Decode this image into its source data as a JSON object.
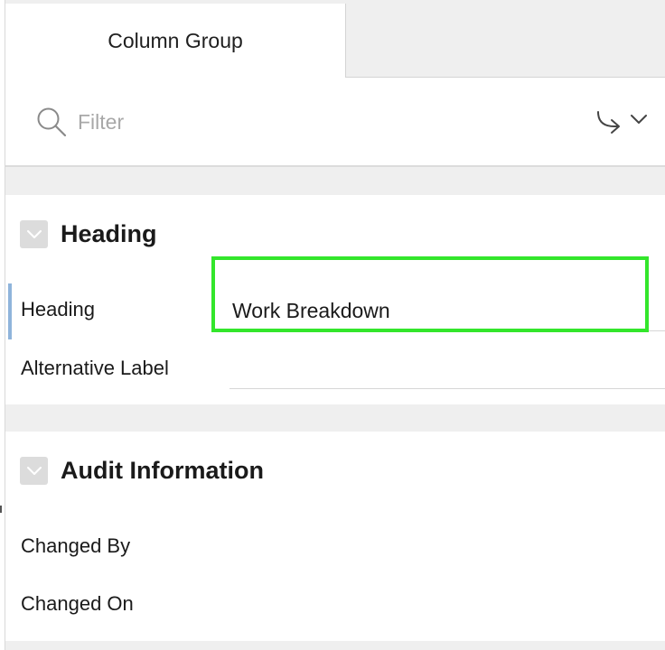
{
  "tabs": [
    {
      "label": "Column Group",
      "active": true
    }
  ],
  "toolbar": {
    "filter_placeholder": "Filter",
    "search_icon": "search-icon",
    "goto_icon": "goto-arrow-chevron-icon"
  },
  "sections": {
    "heading": {
      "title": "Heading",
      "fields": {
        "heading_label": "Heading",
        "heading_value": "Work Breakdown",
        "alt_label": "Alternative Label",
        "alt_value": ""
      }
    },
    "audit": {
      "title": "Audit Information",
      "fields": {
        "changed_by_label": "Changed By",
        "changed_on_label": "Changed On"
      }
    }
  },
  "colors": {
    "highlight": "#33e62b",
    "active_marker": "#8fb4db",
    "background_gap": "#efefef"
  }
}
